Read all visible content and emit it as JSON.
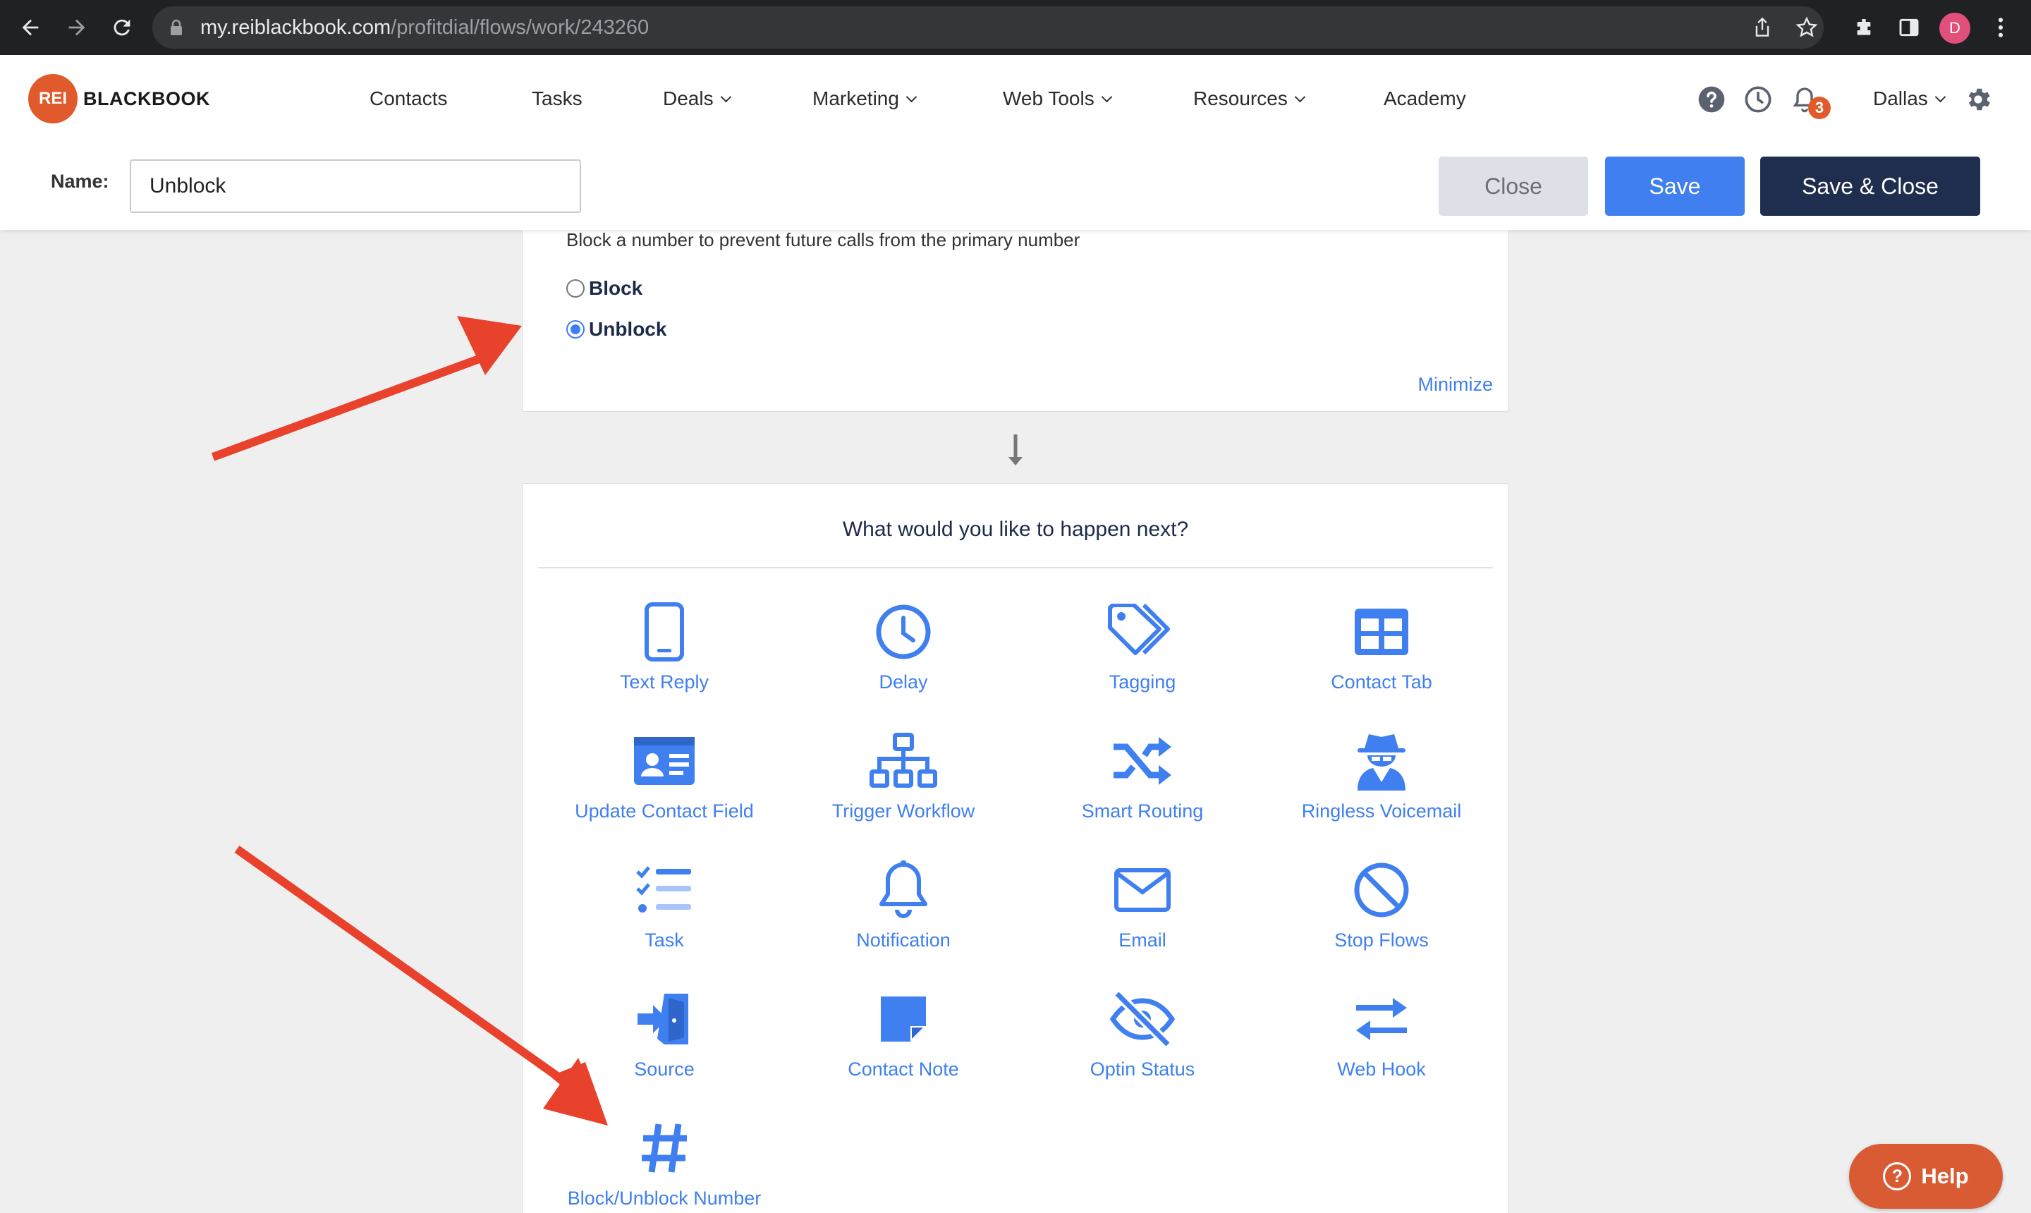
{
  "browser": {
    "url_host": "my.reiblackbook.com",
    "url_path": "/profitdial/flows/work/243260",
    "profile_initial": "D"
  },
  "header": {
    "logo_badge": "REI",
    "logo_text": "BLACKBOOK",
    "nav": [
      {
        "label": "Contacts",
        "has_caret": false
      },
      {
        "label": "Tasks",
        "has_caret": false
      },
      {
        "label": "Deals",
        "has_caret": true
      },
      {
        "label": "Marketing",
        "has_caret": true
      },
      {
        "label": "Web Tools",
        "has_caret": true
      },
      {
        "label": "Resources",
        "has_caret": true
      },
      {
        "label": "Academy",
        "has_caret": false
      }
    ],
    "notification_count": "3",
    "user_name": "Dallas"
  },
  "name_bar": {
    "label": "Name:",
    "value": "Unblock",
    "close_label": "Close",
    "save_label": "Save",
    "save_close_label": "Save & Close"
  },
  "block_step": {
    "description": "Block a number to prevent future calls from the primary number",
    "options": [
      {
        "label": "Block",
        "checked": false
      },
      {
        "label": "Unblock",
        "checked": true
      }
    ],
    "minimize_label": "Minimize"
  },
  "next_step": {
    "heading": "What would you like to happen next?",
    "actions": [
      {
        "label": "Text Reply",
        "icon": "phone-icon"
      },
      {
        "label": "Delay",
        "icon": "clock-icon"
      },
      {
        "label": "Tagging",
        "icon": "tags-icon"
      },
      {
        "label": "Contact Tab",
        "icon": "table-icon"
      },
      {
        "label": "Update Contact Field",
        "icon": "id-card-icon"
      },
      {
        "label": "Trigger Workflow",
        "icon": "sitemap-icon"
      },
      {
        "label": "Smart Routing",
        "icon": "shuffle-icon"
      },
      {
        "label": "Ringless Voicemail",
        "icon": "user-secret-icon"
      },
      {
        "label": "Task",
        "icon": "checklist-icon"
      },
      {
        "label": "Notification",
        "icon": "bell-icon"
      },
      {
        "label": "Email",
        "icon": "envelope-icon"
      },
      {
        "label": "Stop Flows",
        "icon": "ban-icon"
      },
      {
        "label": "Source",
        "icon": "sign-in-icon"
      },
      {
        "label": "Contact Note",
        "icon": "sticky-note-icon"
      },
      {
        "label": "Optin Status",
        "icon": "eye-slash-icon"
      },
      {
        "label": "Web Hook",
        "icon": "exchange-icon"
      },
      {
        "label": "Block/Unblock Number",
        "icon": "hashtag-icon"
      }
    ]
  },
  "help": {
    "label": "Help"
  },
  "colors": {
    "accent": "#3f7ff0",
    "navy": "#1f2d4f",
    "brand": "#e05a2b",
    "annotation": "#e8412c"
  }
}
